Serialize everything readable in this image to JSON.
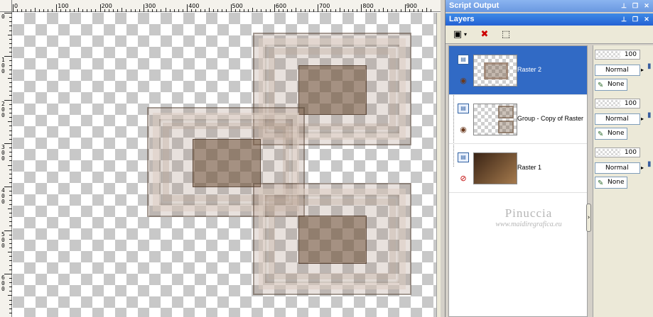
{
  "ruler": {
    "top_labels": [
      "0",
      "100",
      "200",
      "300",
      "400",
      "500",
      "600",
      "700",
      "800",
      "900"
    ],
    "left_labels": [
      "0",
      "100",
      "200",
      "300",
      "400",
      "500",
      "600"
    ]
  },
  "script_output": {
    "title": "Script Output"
  },
  "layers_panel": {
    "title": "Layers",
    "layers": [
      {
        "name": "Raster 2",
        "visibility": "visible",
        "opacity": "100",
        "blend_mode": "Normal",
        "mask": "None",
        "selected": true
      },
      {
        "name": "Group - Copy of Raster",
        "visibility": "visible",
        "opacity": "100",
        "blend_mode": "Normal",
        "mask": "None",
        "selected": false
      },
      {
        "name": "Raster 1",
        "visibility": "hidden",
        "opacity": "100",
        "blend_mode": "Normal",
        "mask": "None",
        "selected": false
      }
    ]
  },
  "watermark": {
    "line1": "Pinuccia",
    "line2": "www.maidiregrafica.eu"
  },
  "colors": {
    "selected_row": "#316ac5",
    "titlebar": "#2461d4",
    "frame_brown": "#6e5037"
  },
  "icons": [
    "new-layer-icon",
    "delete-layer-icon",
    "selection-icon",
    "eye-icon",
    "hidden-eye-icon",
    "brush-icon",
    "lock-icon",
    "pin-icon",
    "restore-icon",
    "close-icon"
  ]
}
